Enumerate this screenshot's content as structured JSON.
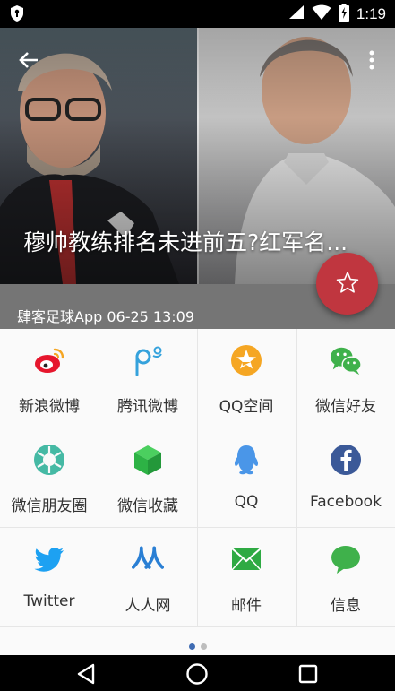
{
  "status_bar": {
    "time": "1:19",
    "icons": [
      "shield-icon",
      "wifi-icon",
      "signal-icon",
      "battery-charging-icon"
    ]
  },
  "article": {
    "title": "穆帅教练排名未进前五?红军名...",
    "meta": "肆客足球App 06-25 13:09"
  },
  "share": {
    "items": [
      {
        "label": "新浪微博",
        "icon": "weibo-icon",
        "color": "#e6162d"
      },
      {
        "label": "腾讯微博",
        "icon": "tencent-weibo-icon",
        "color": "#35a2dc"
      },
      {
        "label": "QQ空间",
        "icon": "qzone-icon",
        "color": "#f5a623"
      },
      {
        "label": "微信好友",
        "icon": "wechat-icon",
        "color": "#3fb14b"
      },
      {
        "label": "微信朋友圈",
        "icon": "moments-icon",
        "color": "#45b9a4"
      },
      {
        "label": "微信收藏",
        "icon": "wechat-favorite-icon",
        "color": "#2db245"
      },
      {
        "label": "QQ",
        "icon": "qq-icon",
        "color": "#4a96e8"
      },
      {
        "label": "Facebook",
        "icon": "facebook-icon",
        "color": "#3b5998"
      },
      {
        "label": "Twitter",
        "icon": "twitter-icon",
        "color": "#1da1f2"
      },
      {
        "label": "人人网",
        "icon": "renren-icon",
        "color": "#2a7fd4"
      },
      {
        "label": "邮件",
        "icon": "email-icon",
        "color": "#2eaa43"
      },
      {
        "label": "信息",
        "icon": "sms-icon",
        "color": "#3fb14b"
      }
    ],
    "pager": {
      "pages": 2,
      "current": 1
    }
  },
  "colors": {
    "fab": "#c0363f",
    "meta_bar": "#757575",
    "sheet_bg": "#fafafa",
    "pager_active": "#3f6cb3",
    "pager_inactive": "#bdbdbd"
  }
}
